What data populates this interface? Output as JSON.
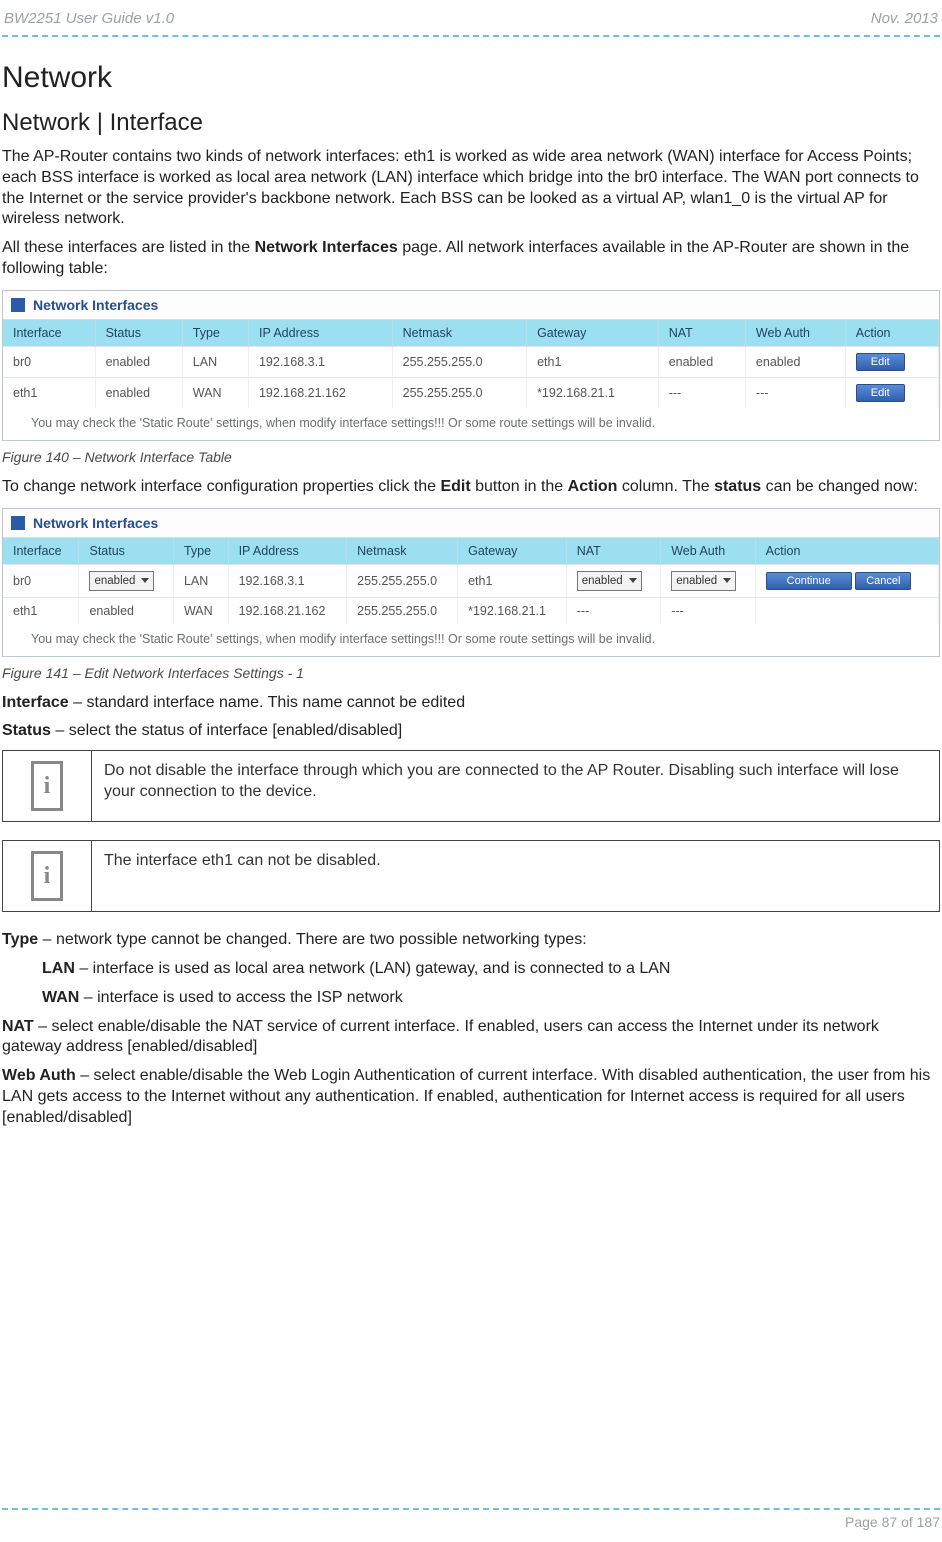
{
  "header": {
    "left": "BW2251 User Guide v1.0",
    "right": "Nov.  2013"
  },
  "section_title": "Network",
  "subsection_title": "Network | Interface",
  "para1": "The AP-Router contains two kinds of network interfaces: eth1 is worked as wide area network (WAN) interface for Access Points; each BSS interface is worked as local area network (LAN) interface which bridge into the br0 interface. The WAN port connects to the Internet or the service provider's backbone network. Each BSS can be looked as a virtual AP, wlan1_0 is the virtual AP for wireless network.",
  "para2_pre": "All these interfaces are listed in the ",
  "para2_bold": "Network Interfaces",
  "para2_post": " page. All network interfaces available in the AP-Router are shown in the following table:",
  "table1": {
    "title": "Network Interfaces",
    "headers": [
      "Interface",
      "Status",
      "Type",
      "IP Address",
      "Netmask",
      "Gateway",
      "NAT",
      "Web Auth",
      "Action"
    ],
    "rows": [
      [
        "br0",
        "enabled",
        "LAN",
        "192.168.3.1",
        "255.255.255.0",
        "eth1",
        "enabled",
        "enabled",
        "Edit"
      ],
      [
        "eth1",
        "enabled",
        "WAN",
        "192.168.21.162",
        "255.255.255.0",
        "*192.168.21.1",
        "---",
        "---",
        "Edit"
      ]
    ],
    "note": "You may check the 'Static Route' settings, when modify interface settings!!! Or some route settings will be invalid."
  },
  "fig1_caption": "Figure 140 – Network Interface Table",
  "para3_pre": "To change network interface configuration properties click the ",
  "para3_b1": "Edit",
  "para3_mid": " button in the ",
  "para3_b2": "Action",
  "para3_post": " column. The ",
  "para3_b3": "status",
  "para3_tail": " can be changed now:",
  "table2": {
    "title": "Network Interfaces",
    "headers": [
      "Interface",
      "Status",
      "Type",
      "IP Address",
      "Netmask",
      "Gateway",
      "NAT",
      "Web Auth",
      "Action"
    ],
    "row0": {
      "iface": "br0",
      "status_sel": "enabled",
      "type": "LAN",
      "ip": "192.168.3.1",
      "mask": "255.255.255.0",
      "gw": "eth1",
      "nat_sel": "enabled",
      "web_sel": "enabled",
      "actions": [
        "Continue",
        "Cancel"
      ]
    },
    "row1": [
      "eth1",
      "enabled",
      "WAN",
      "192.168.21.162",
      "255.255.255.0",
      "*192.168.21.1",
      "---",
      "---",
      ""
    ],
    "note": "You may check the 'Static Route' settings, when modify interface settings!!! Or some route settings will be invalid."
  },
  "fig2_caption": "Figure 141 – Edit Network Interfaces Settings - 1",
  "def_interface_label": "Interface",
  "def_interface_text": " – standard interface name. This name cannot be edited",
  "def_status_label": "Status",
  "def_status_text": " – select the status of interface [enabled/disabled]",
  "note1_text": "Do not disable the interface through which you are connected to the AP Router. Disabling such interface will lose your connection to the device.",
  "note2_text": "The interface eth1 can not be disabled.",
  "def_type_label": "Type",
  "def_type_text": " – network type cannot be changed. There are two possible networking types:",
  "def_lan_label": "LAN",
  "def_lan_text": " – interface is used as local area network (LAN) gateway, and is connected to a LAN",
  "def_wan_label": "WAN",
  "def_wan_text": " – interface is used to access the ISP network",
  "def_nat_label": "NAT",
  "def_nat_text": " – select enable/disable the NAT service of current interface. If enabled, users can access the Internet under its network gateway address [enabled/disabled]",
  "def_webauth_label": "Web Auth",
  "def_webauth_text": " – select enable/disable the Web Login Authentication of current interface. With disabled authentication, the user from his LAN gets access to the Internet without any authentication. If enabled, authentication for Internet access is required for all users [enabled/disabled]",
  "footer_page": "Page 87 of 187",
  "chart_data": {
    "type": "table",
    "tables": [
      {
        "title": "Network Interfaces (view)",
        "columns": [
          "Interface",
          "Status",
          "Type",
          "IP Address",
          "Netmask",
          "Gateway",
          "NAT",
          "Web Auth",
          "Action"
        ],
        "rows": [
          [
            "br0",
            "enabled",
            "LAN",
            "192.168.3.1",
            "255.255.255.0",
            "eth1",
            "enabled",
            "enabled",
            "Edit"
          ],
          [
            "eth1",
            "enabled",
            "WAN",
            "192.168.21.162",
            "255.255.255.0",
            "*192.168.21.1",
            "---",
            "---",
            "Edit"
          ]
        ]
      },
      {
        "title": "Network Interfaces (edit)",
        "columns": [
          "Interface",
          "Status",
          "Type",
          "IP Address",
          "Netmask",
          "Gateway",
          "NAT",
          "Web Auth",
          "Action"
        ],
        "rows": [
          [
            "br0",
            "enabled",
            "LAN",
            "192.168.3.1",
            "255.255.255.0",
            "eth1",
            "enabled",
            "enabled",
            "Continue / Cancel"
          ],
          [
            "eth1",
            "enabled",
            "WAN",
            "192.168.21.162",
            "255.255.255.0",
            "*192.168.21.1",
            "---",
            "---",
            ""
          ]
        ]
      }
    ]
  }
}
